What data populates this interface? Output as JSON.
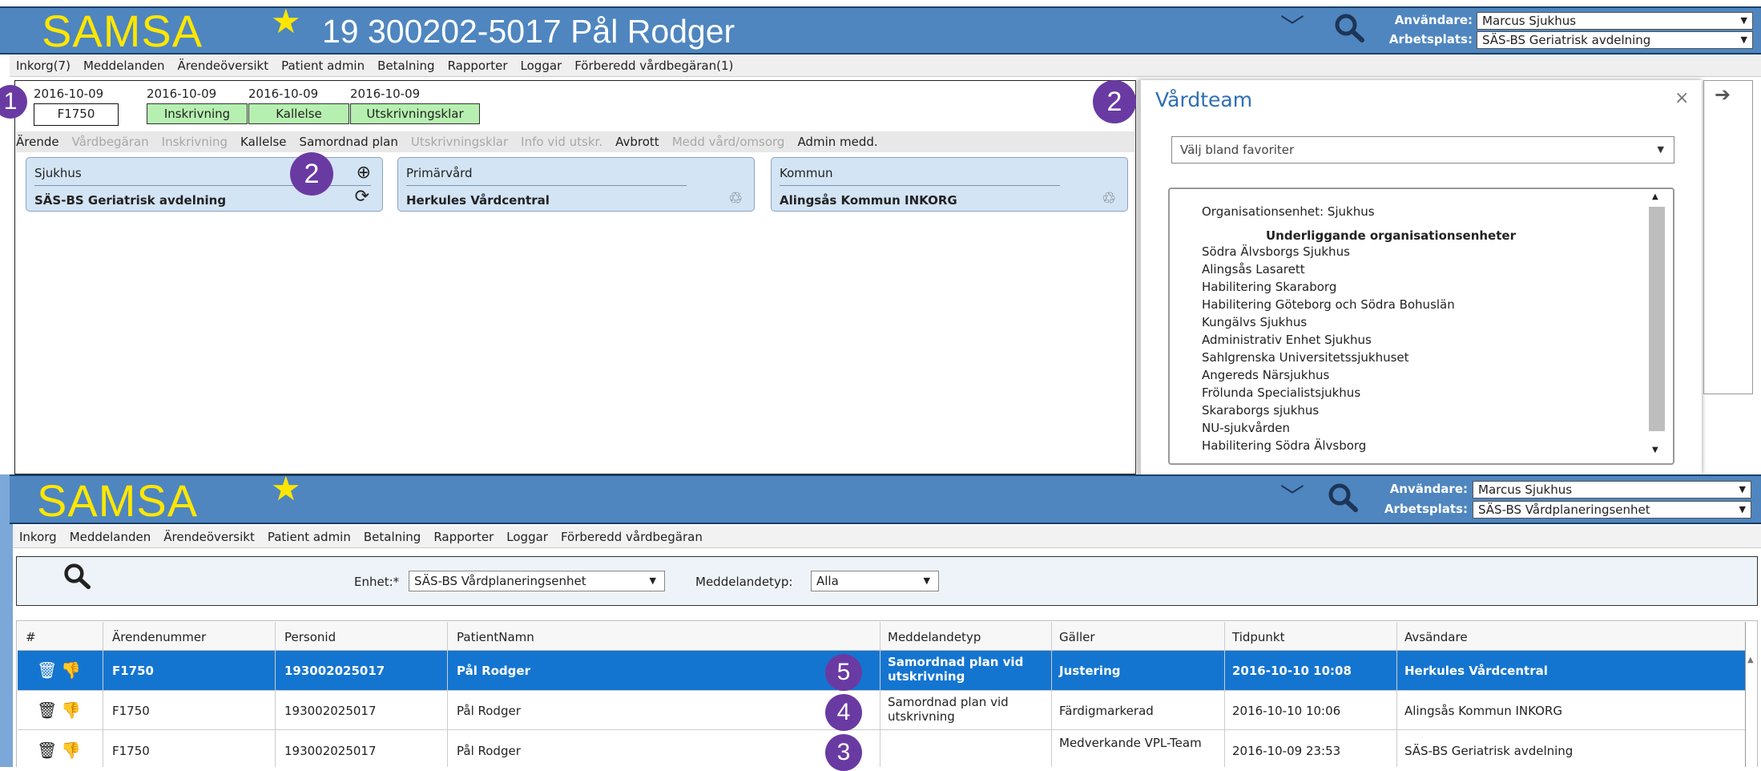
{
  "top": {
    "logo": "SAMSA",
    "patient_title": "19 300202-5017 Pål Rodger",
    "user_label": "Användare:",
    "user_value": "Marcus Sjukhus",
    "workplace_label": "Arbetsplats:",
    "workplace_value": "SÄS-BS Geriatrisk avdelning",
    "menu": [
      "Inkorg(7)",
      "Meddelanden",
      "Ärendeöversikt",
      "Patient admin",
      "Betalning",
      "Rapporter",
      "Loggar",
      "Förberedd vårdbegäran(1)"
    ]
  },
  "case": {
    "dates": [
      "2016-10-09",
      "2016-10-09",
      "2016-10-09",
      "2016-10-09"
    ],
    "case_id": "F1750",
    "tags": [
      "Inskrivning",
      "Kallelse",
      "Utskrivningsklar"
    ],
    "tabs": [
      {
        "label": "Ärende",
        "enabled": true
      },
      {
        "label": "Vårdbegäran",
        "enabled": false
      },
      {
        "label": "Inskrivning",
        "enabled": false
      },
      {
        "label": "Kallelse",
        "enabled": true
      },
      {
        "label": "Samordnad plan",
        "enabled": true
      },
      {
        "label": "Utskrivningsklar",
        "enabled": false
      },
      {
        "label": "Info vid utskr.",
        "enabled": false
      },
      {
        "label": "Avbrott",
        "enabled": true
      },
      {
        "label": "Medd vård/omsorg",
        "enabled": false
      },
      {
        "label": "Admin medd.",
        "enabled": true
      }
    ],
    "cards": [
      {
        "title": "Sjukhus",
        "value": "SÄS-BS Geriatrisk avdelning"
      },
      {
        "title": "Primärvård",
        "value": "Herkules Vårdcentral"
      },
      {
        "title": "Kommun",
        "value": "Alingsås Kommun INKORG"
      }
    ]
  },
  "vardteam": {
    "title": "Vårdteam",
    "favorites_placeholder": "Välj bland favoriter",
    "org_label": "Organisationsenhet: Sjukhus",
    "sub_header": "Underliggande organisationsenheter",
    "units": [
      "Södra Älvsborgs Sjukhus",
      "Alingsås Lasarett",
      "Habilitering Skaraborg",
      "Habilitering Göteborg och Södra Bohuslän",
      "Kungälvs Sjukhus",
      "Administrativ Enhet Sjukhus",
      "Sahlgrenska Universitetssjukhuset",
      "Angereds Närsjukhus",
      "Frölunda Specialistsjukhus",
      "Skaraborgs sjukhus",
      "NU-sjukvården",
      "Habilitering Södra Älvsborg"
    ]
  },
  "bottom": {
    "logo": "SAMSA",
    "user_label": "Användare:",
    "user_value": "Marcus Sjukhus",
    "workplace_label": "Arbetsplats:",
    "workplace_value": "SÄS-BS Vårdplaneringsenhet",
    "menu": [
      "Inkorg",
      "Meddelanden",
      "Ärendeöversikt",
      "Patient admin",
      "Betalning",
      "Rapporter",
      "Loggar",
      "Förberedd vårdbegäran"
    ],
    "unit_label": "Enhet:*",
    "unit_value": "SÄS-BS Vårdplaneringsenhet",
    "msgtype_label": "Meddelandetyp:",
    "msgtype_value": "Alla",
    "columns": [
      "#",
      "Ärendenummer",
      "Personid",
      "PatientNamn",
      "Meddelandetyp",
      "Gäller",
      "Tidpunkt",
      "Avsändare"
    ],
    "rows": [
      {
        "case": "F1750",
        "personid": "193002025017",
        "name": "Pål Rodger",
        "msgtype": "Samordnad plan vid utskrivning",
        "regarding": "Justering",
        "time": "2016-10-10 10:08",
        "sender": "Herkules Vårdcentral"
      },
      {
        "case": "F1750",
        "personid": "193002025017",
        "name": "Pål Rodger",
        "msgtype": "Samordnad plan vid utskrivning",
        "regarding": "Färdigmarkerad",
        "time": "2016-10-10 10:06",
        "sender": "Alingsås Kommun INKORG"
      },
      {
        "case": "F1750",
        "personid": "193002025017",
        "name": "Pål Rodger",
        "msgtype": "",
        "regarding": "Medverkande VPL-Team",
        "time": "2016-10-09 23:53",
        "sender": "SÄS-BS Geriatrisk avdelning"
      }
    ]
  },
  "badges": [
    "1",
    "2",
    "2",
    "5",
    "4",
    "3"
  ],
  "colors": {
    "header": "#4f86bf",
    "logo": "#ffe600",
    "selected_row": "#1475d0",
    "tag": "#b6f0b0",
    "card": "#d3e4f5",
    "badge": "#6a3aa3"
  }
}
